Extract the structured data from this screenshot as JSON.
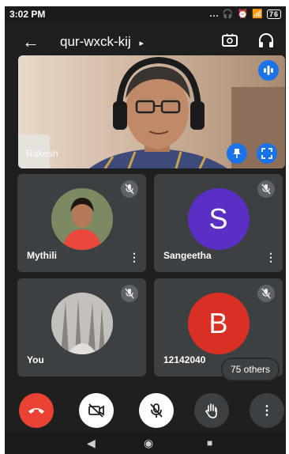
{
  "status_bar": {
    "time": "3:02 PM",
    "icons_text": "...",
    "battery": "76"
  },
  "app_bar": {
    "meeting_code": "qur-wxck-kij",
    "caret": "▸",
    "back_icon": "arrow-left-icon",
    "switch_camera_icon": "switch-camera-icon",
    "audio_icon": "headphones-icon"
  },
  "main_video": {
    "participant_name": "Rakesh",
    "pin_icon": "pin-icon",
    "fullscreen_icon": "fullscreen-icon",
    "speaking_icon": "speaking-indicator-icon"
  },
  "tiles": [
    {
      "name": "Mythili",
      "avatar_type": "photo",
      "muted": true,
      "menu": "⋮"
    },
    {
      "name": "Sangeetha",
      "avatar_letter": "S",
      "avatar_color": "#5b2fc4",
      "muted": true,
      "menu": "⋮"
    },
    {
      "name": "You",
      "avatar_type": "photo",
      "muted": true
    },
    {
      "name": "12142040",
      "avatar_letter": "B",
      "avatar_color": "#d93025",
      "muted": true
    }
  ],
  "others_badge": "75 others",
  "controls": {
    "end_call_color": "#ea4335",
    "buttons": [
      "end-call",
      "camera-off",
      "mic-off",
      "raise-hand",
      "more"
    ],
    "more_label": "⋮"
  },
  "nav_bar": {
    "back": "◀",
    "home": "◉",
    "recents": "■"
  }
}
